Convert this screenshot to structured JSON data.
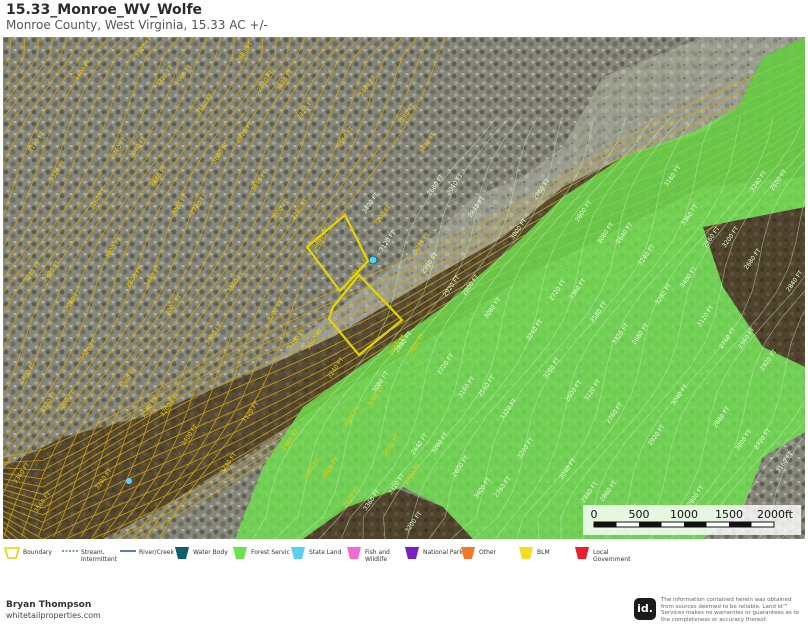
{
  "header": {
    "title": "15.33_Monroe_WV_Wolfe",
    "subtitle": "Monroe County, West Virginia, 15.33 AC +/-"
  },
  "colors": {
    "boundary": "#e4d400",
    "contour": "#d9a800",
    "forest_service": "#6fe14f",
    "stream": "#2e5f9e",
    "water_body": "#0d5f6b",
    "state_land": "#5ad0ef",
    "fish_wildlife": "#f06ad8",
    "national_park": "#7a1fc4",
    "other": "#f07a28",
    "blm": "#f7dc1f",
    "local_government": "#e8202a"
  },
  "map": {
    "contour_labels_outside": [
      "3680 FT",
      "3600 FT",
      "3520 FT",
      "3440 FT",
      "3360 FT",
      "3280 FT",
      "3200 FT",
      "3120 FT",
      "3040 FT",
      "2960 FT",
      "2880 FT",
      "2800 FT",
      "2720 FT",
      "3000 FT",
      "3560 FT",
      "3480 FT",
      "3400 FT",
      "3320 FT",
      "3240 FT",
      "3160 FT",
      "3080 FT",
      "2920 FT"
    ],
    "contour_labels_forest": [
      "3360 FT",
      "3280 FT",
      "3200 FT",
      "3120 FT",
      "3040 FT",
      "2960 FT",
      "2880 FT",
      "2800 FT",
      "2720 FT",
      "2640 FT",
      "2560 FT",
      "2600 FT",
      "2680 FT",
      "2760 FT",
      "2840 FT",
      "2920 FT",
      "3000 FT",
      "3080 FT",
      "3160 FT",
      "3240 FT",
      "3320 FT",
      "3400 FT"
    ]
  },
  "scale": {
    "ticks": [
      "0",
      "500",
      "1000",
      "1500",
      "2000ft"
    ]
  },
  "legend": {
    "items": [
      {
        "label": "Boundary",
        "icon": "boundary-icon"
      },
      {
        "label": "Stream, Intermittent",
        "icon": "stream-intermittent-icon"
      },
      {
        "label": "River/Creek",
        "icon": "river-icon"
      },
      {
        "label": "Water Body",
        "icon": "water-body-icon"
      },
      {
        "label": "Forest Servic",
        "icon": "forest-service-icon"
      },
      {
        "label": "State Land",
        "icon": "state-land-icon"
      },
      {
        "label": "Fish and Wildlife",
        "icon": "fish-wildlife-icon"
      },
      {
        "label": "National Park",
        "icon": "national-park-icon"
      },
      {
        "label": "Other",
        "icon": "other-icon"
      },
      {
        "label": "BLM",
        "icon": "blm-icon"
      },
      {
        "label": "Local Government",
        "icon": "local-government-icon"
      }
    ]
  },
  "footer": {
    "agent_name": "Bryan Thompson",
    "website": "whitetailproperties.com",
    "logo_text": "id.",
    "disclaimer": "The information contained herein was obtained from sources deemed to be reliable. Land id™ Services makes no warranties or guarantees as to the completeness or accuracy thereof."
  }
}
